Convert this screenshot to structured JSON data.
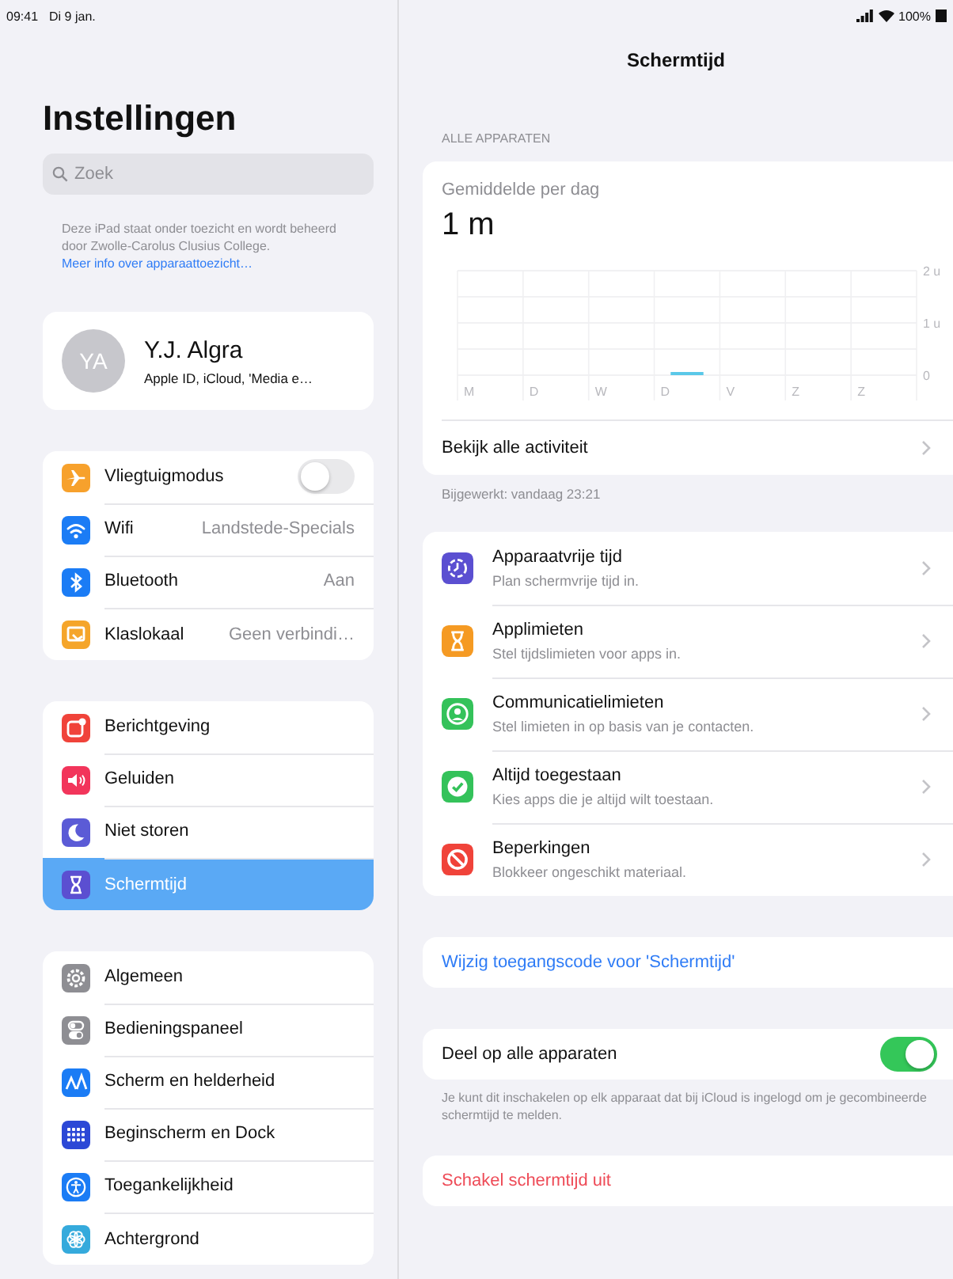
{
  "status_bar": {
    "time": "09:41",
    "date": "Di 9 jan.",
    "battery": "100%"
  },
  "sidebar": {
    "title": "Instellingen",
    "search": {
      "placeholder": "Zoek"
    },
    "supervision_note": {
      "text": "Deze iPad staat onder toezicht en wordt beheerd door Zwolle-Carolus Clusius College.",
      "link": "Meer info over apparaattoezicht…"
    },
    "profile": {
      "initials": "YA",
      "name": "Y.J. Algra",
      "subtitle": "Apple ID, iCloud, 'Media e…"
    },
    "groups": [
      {
        "items": [
          {
            "label": "Vliegtuigmodus",
            "kind": "toggle",
            "on": false,
            "selected": false,
            "color": "#f7a12c"
          },
          {
            "label": "Wifi",
            "kind": "value",
            "value": "Landstede-Specials",
            "selected": false,
            "color": "#1b7cf5"
          },
          {
            "label": "Bluetooth",
            "kind": "value",
            "value": "Aan",
            "selected": false,
            "color": "#1b7cf5"
          },
          {
            "label": "Klaslokaal",
            "kind": "value",
            "value": "Geen verbindi…",
            "selected": false,
            "color": "#f5a52a"
          }
        ]
      },
      {
        "items": [
          {
            "label": "Berichtgeving",
            "kind": "link",
            "selected": false,
            "color": "#f0433a"
          },
          {
            "label": "Geluiden",
            "kind": "link",
            "selected": false,
            "color": "#f2355b"
          },
          {
            "label": "Niet storen",
            "kind": "link",
            "selected": false,
            "color": "#5b5bd6"
          },
          {
            "label": "Schermtijd",
            "kind": "link",
            "selected": true,
            "color": "#5b4fd1"
          }
        ]
      },
      {
        "items": [
          {
            "label": "Algemeen",
            "kind": "link",
            "selected": false,
            "color": "#8e8e93"
          },
          {
            "label": "Bedieningspaneel",
            "kind": "link",
            "selected": false,
            "color": "#8e8e93"
          },
          {
            "label": "Scherm en helderheid",
            "kind": "link",
            "selected": false,
            "color": "#1b7cf5"
          },
          {
            "label": "Beginscherm en Dock",
            "kind": "link",
            "selected": false,
            "color": "#2c48d6"
          },
          {
            "label": "Toegankelijkheid",
            "kind": "link",
            "selected": false,
            "color": "#1b7cf5"
          },
          {
            "label": "Achtergrond",
            "kind": "link",
            "selected": false,
            "color": "#35aadc"
          }
        ]
      }
    ]
  },
  "detail": {
    "title": "Schermtijd",
    "section_header": "ALLE APPARATEN",
    "summary": {
      "label": "Gemiddelde per dag",
      "value": "1 m",
      "chart_data": {
        "type": "bar",
        "categories": [
          "M",
          "D",
          "W",
          "D",
          "V",
          "Z",
          "Z"
        ],
        "values": [
          0,
          0,
          0,
          0.03,
          0,
          0,
          0
        ],
        "ylim": [
          0,
          2
        ],
        "yticks": [
          {
            "value": 0,
            "label": "0"
          },
          {
            "value": 1,
            "label": "1 u"
          },
          {
            "value": 2,
            "label": "2 u"
          }
        ]
      },
      "activity_link": "Bekijk alle activiteit"
    },
    "updated": "Bijgewerkt: vandaag 23:21",
    "options": [
      {
        "title": "Apparaatvrije tijd",
        "subtitle": "Plan schermvrije tijd in.",
        "color": "#5b4fd1"
      },
      {
        "title": "Applimieten",
        "subtitle": "Stel tijdslimieten voor apps in.",
        "color": "#f59a23"
      },
      {
        "title": "Communicatielimieten",
        "subtitle": "Stel limieten in op basis van je contacten.",
        "color": "#34c25a"
      },
      {
        "title": "Altijd toegestaan",
        "subtitle": "Kies apps die je altijd wilt toestaan.",
        "color": "#34c25a"
      },
      {
        "title": "Beperkingen",
        "subtitle": "Blokkeer ongeschikt materiaal.",
        "color": "#f0433a"
      }
    ],
    "passcode_link": "Wijzig toegangscode voor 'Schermtijd'",
    "share": {
      "label": "Deel op alle apparaten",
      "on": true,
      "footnote": "Je kunt dit inschakelen op elk apparaat dat bij iCloud is ingelogd om je gecombineerde schermtijd te melden."
    },
    "turn_off": "Schakel schermtijd uit"
  }
}
